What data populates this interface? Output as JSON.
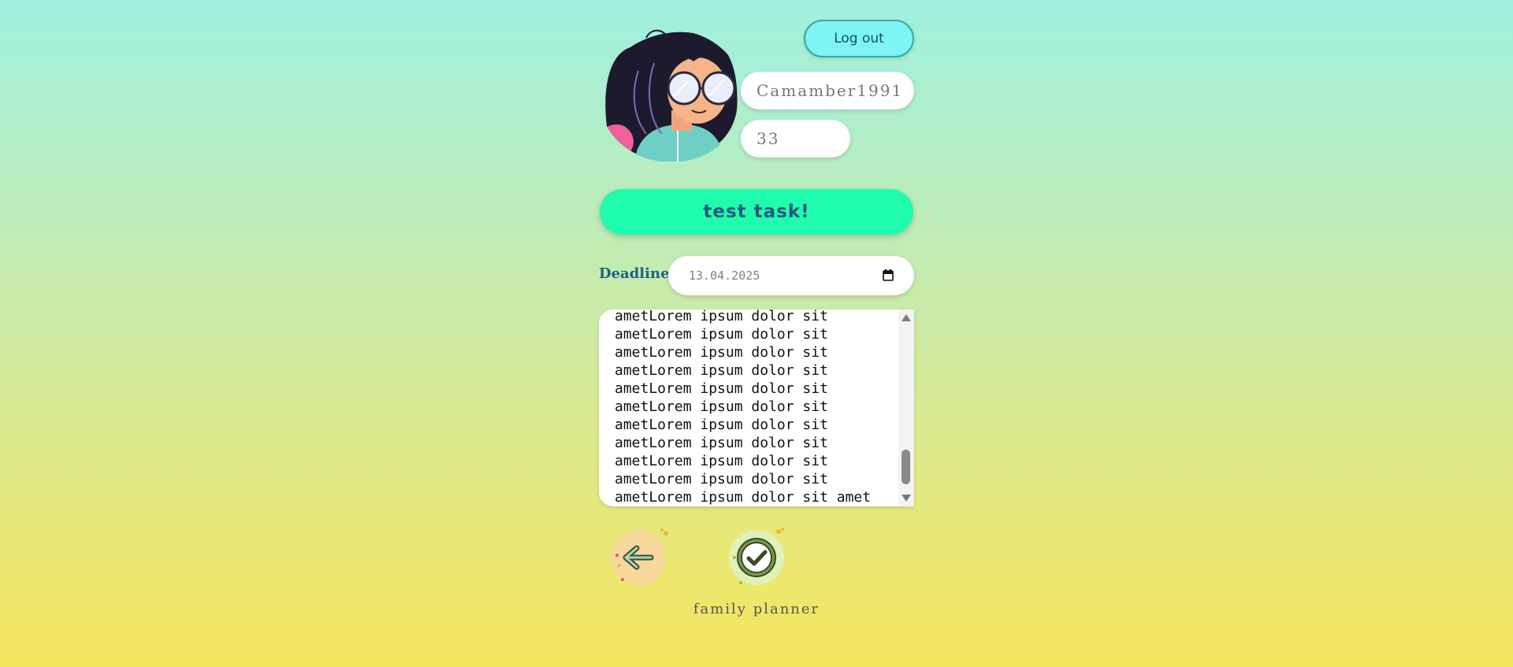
{
  "header": {
    "logout_label": "Log out",
    "avatar_icon": "girl-with-glasses-avatar"
  },
  "profile": {
    "username": "Camamber1991",
    "age": "33"
  },
  "task": {
    "title": "test task!",
    "deadline_label": "Deadline:",
    "deadline_value": "13.04.2025",
    "description": "ametLorem ipsum dolor sit\nametLorem ipsum dolor sit\nametLorem ipsum dolor sit\nametLorem ipsum dolor sit\nametLorem ipsum dolor sit\nametLorem ipsum dolor sit\nametLorem ipsum dolor sit\nametLorem ipsum dolor sit\nametLorem ipsum dolor sit\nametLorem ipsum dolor sit\nametLorem ipsum dolor sit amet"
  },
  "actions": {
    "back_icon": "arrow-left-icon",
    "done_icon": "checkmark-icon"
  },
  "footer": {
    "title": "family planner"
  },
  "colors": {
    "accent": "#1ffcad",
    "logout_bg": "#7ef4f4",
    "title_text": "#1c5a80"
  }
}
